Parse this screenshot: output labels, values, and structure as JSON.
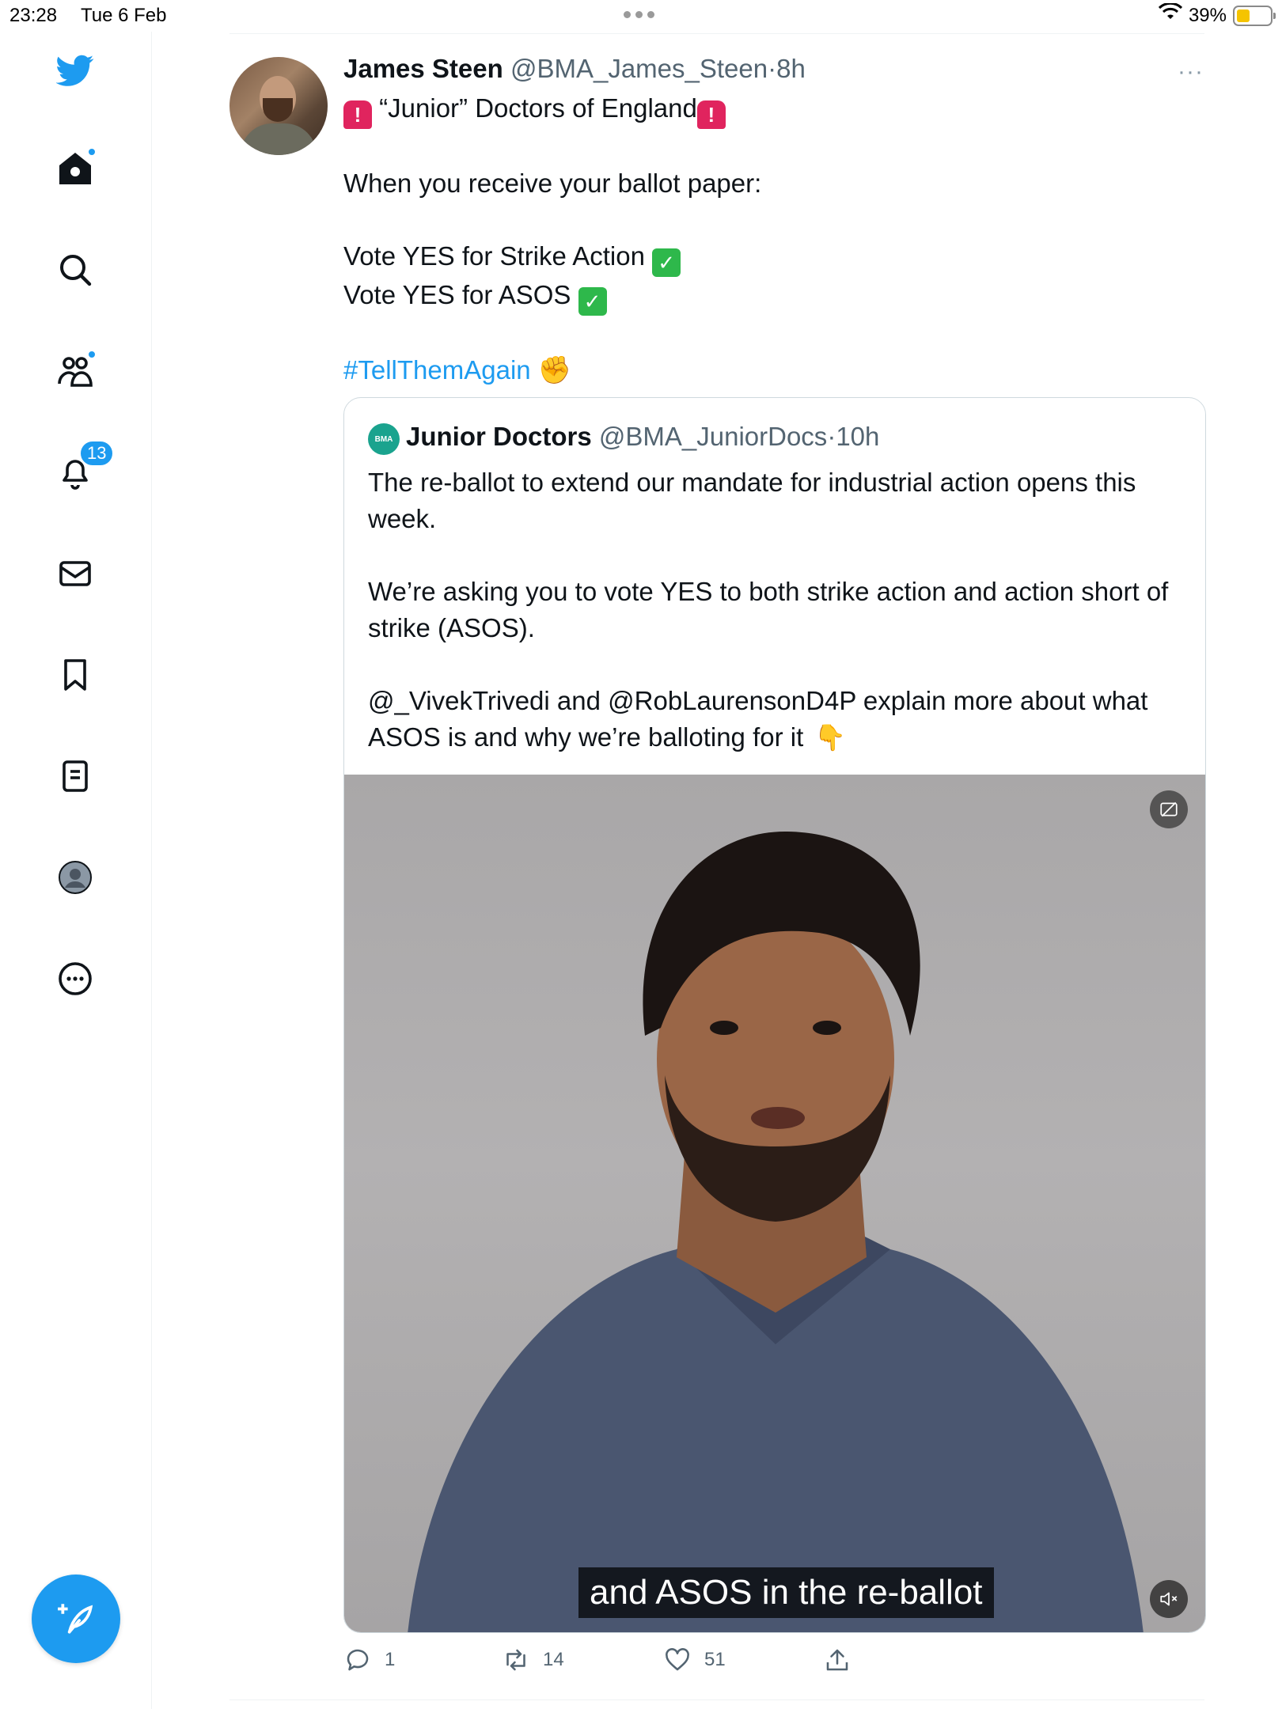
{
  "status_bar": {
    "time": "23:28",
    "date": "Tue 6 Feb",
    "battery": "39%"
  },
  "sidebar": {
    "items": [
      {
        "name": "twitter-logo",
        "icon": "bird-icon"
      },
      {
        "name": "home",
        "icon": "home-icon"
      },
      {
        "name": "explore",
        "icon": "search-icon"
      },
      {
        "name": "communities",
        "icon": "people-icon"
      },
      {
        "name": "notifications",
        "icon": "bell-icon",
        "badge": "13"
      },
      {
        "name": "messages",
        "icon": "mail-icon"
      },
      {
        "name": "bookmarks",
        "icon": "bookmark-icon"
      },
      {
        "name": "lists",
        "icon": "list-icon"
      },
      {
        "name": "profile",
        "icon": "profile-icon"
      },
      {
        "name": "more",
        "icon": "more-circle-icon"
      }
    ],
    "compose_icon": "feather-plus-icon"
  },
  "tweet": {
    "author_name": "James Steen",
    "author_handle": "@BMA_James_Steen",
    "sep": "·",
    "time": "8h",
    "more": "···",
    "lines": {
      "l1": "“Junior” Doctors of England",
      "l2": "When you receive your ballot paper:",
      "l3": "Vote YES for Strike Action",
      "l4": "Vote YES for ASOS",
      "hashtag": "#TellThemAgain"
    }
  },
  "quoted": {
    "avatar_text": "BMA",
    "author_name": "Junior Doctors",
    "author_handle": "@BMA_JuniorDocs",
    "sep": "·",
    "time": "10h",
    "p1": "The re-ballot to extend our mandate for industrial action opens this week.",
    "p2": "We’re asking you to vote YES to both strike action and action short of strike (ASOS).",
    "p3": "@_VivekTrivedi and @RobLaurensonD4P explain more about what ASOS is and why we’re balloting for it",
    "video_caption": "and ASOS in the re-ballot"
  },
  "actions": {
    "replies": "1",
    "retweets": "14",
    "likes": "51"
  },
  "colors": {
    "accent": "#1d9bf0",
    "text": "#0f1419",
    "muted": "#536471",
    "border": "#cfd9de"
  }
}
